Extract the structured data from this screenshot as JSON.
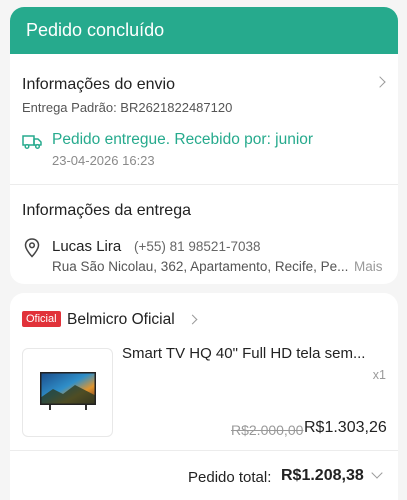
{
  "header": {
    "title": "Pedido concluído"
  },
  "shipping": {
    "title": "Informações do envio",
    "tracking": "Entrega Padrão: BR2621822487120",
    "status": "Pedido entregue. Recebido por: junior",
    "date": "23-04-2026 16:23",
    "status_color": "#26aa8d"
  },
  "delivery": {
    "title": "Informações da entrega",
    "name": "Lucas Lira",
    "phone": "(+55) 81 98521-7038",
    "address": "Rua São Nicolau, 362, Apartamento, Recife, Pe...",
    "more": "Mais"
  },
  "store": {
    "badge": "Oficial",
    "name": "Belmicro Oficial",
    "badge_color": "#e1323a"
  },
  "product": {
    "title": "Smart TV HQ 40\" Full HD tela sem...",
    "quantity": "x1",
    "price_original": "R$2.000,00",
    "price_current": "R$1.303,26"
  },
  "order": {
    "total_label": "Pedido total:",
    "total_value": "R$1.208,38"
  }
}
